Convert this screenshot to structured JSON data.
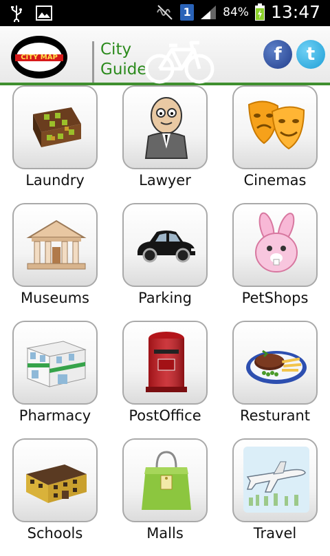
{
  "status_bar": {
    "battery_percent": "84%",
    "time": "13:47",
    "sim_number": "1"
  },
  "header": {
    "logo_text": "CITY MAP",
    "title_line1": "City",
    "title_line2": "Guide",
    "facebook_letter": "f",
    "twitter_letter": "t"
  },
  "categories": [
    {
      "label": "Laundry",
      "icon": "laundry-icon"
    },
    {
      "label": "Lawyer",
      "icon": "lawyer-icon"
    },
    {
      "label": "Cinemas",
      "icon": "cinema-masks-icon"
    },
    {
      "label": "Museums",
      "icon": "museum-icon"
    },
    {
      "label": "Parking",
      "icon": "car-icon"
    },
    {
      "label": "PetShops",
      "icon": "bunny-icon"
    },
    {
      "label": "Pharmacy",
      "icon": "pharmacy-building-icon"
    },
    {
      "label": "PostOffice",
      "icon": "postbox-icon"
    },
    {
      "label": "Resturant",
      "icon": "steak-plate-icon"
    },
    {
      "label": "Schools",
      "icon": "school-building-icon"
    },
    {
      "label": "Malls",
      "icon": "shopping-bag-icon"
    },
    {
      "label": "Travel",
      "icon": "airplane-icon"
    }
  ],
  "colors": {
    "accent_green": "#3f8f2f",
    "title_green": "#2b8a1c",
    "facebook_blue": "#2f56a8",
    "twitter_blue": "#2aa9e0"
  }
}
